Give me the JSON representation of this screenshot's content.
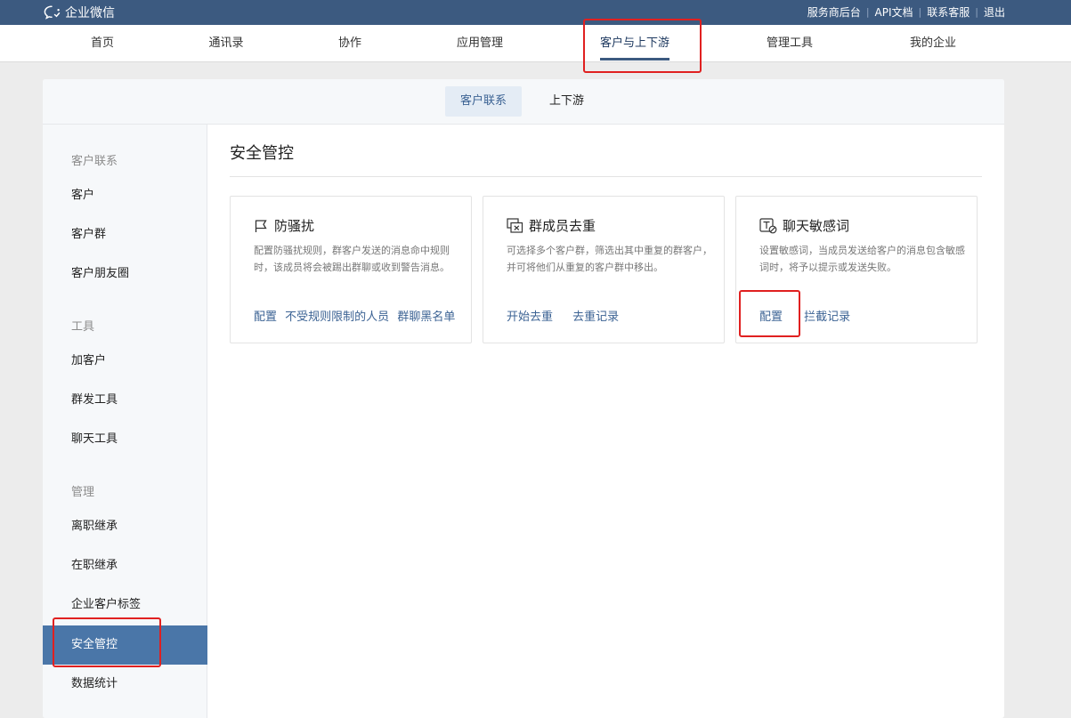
{
  "app": {
    "logo_text": "企业微信"
  },
  "top_links": [
    "服务商后台",
    "API文档",
    "联系客服",
    "退出"
  ],
  "main_nav": [
    "首页",
    "通讯录",
    "协作",
    "应用管理",
    "客户与上下游",
    "管理工具",
    "我的企业"
  ],
  "sub_tabs": [
    "客户联系",
    "上下游"
  ],
  "sidebar": {
    "group1": "客户联系",
    "item_customer": "客户",
    "item_customer_group": "客户群",
    "item_moments": "客户朋友圈",
    "group2": "工具",
    "item_add_customer": "加客户",
    "item_mass_send": "群发工具",
    "item_chat_tools": "聊天工具",
    "group3": "管理",
    "item_resign_transfer": "离职继承",
    "item_onjob_transfer": "在职继承",
    "item_tags": "企业客户标签",
    "item_security": "安全管控",
    "item_stats": "数据统计"
  },
  "content": {
    "title": "安全管控",
    "cards": [
      {
        "title": "防骚扰",
        "desc": "配置防骚扰规则，群客户发送的消息命中规则时，该成员将会被踢出群聊或收到警告消息。",
        "links": [
          "配置",
          "不受规则限制的人员",
          "群聊黑名单"
        ]
      },
      {
        "title": "群成员去重",
        "desc": "可选择多个客户群，筛选出其中重复的群客户，并可将他们从重复的客户群中移出。",
        "links": [
          "开始去重",
          "去重记录"
        ]
      },
      {
        "title": "聊天敏感词",
        "desc": "设置敏感词，当成员发送给客户的消息包含敏感词时，将予以提示或发送失败。",
        "links": [
          "配置",
          "拦截记录"
        ]
      }
    ]
  },
  "colors": {
    "topbar": "#3c5a80",
    "accent": "#4a76a8",
    "link": "#3c6394",
    "highlight": "#e02020"
  }
}
